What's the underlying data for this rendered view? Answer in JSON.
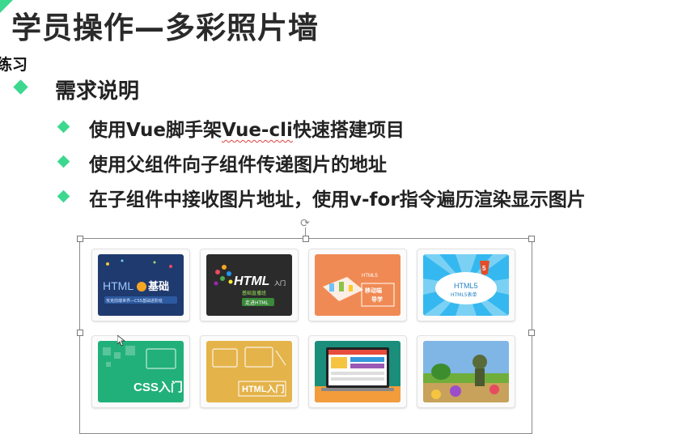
{
  "slide": {
    "title": "学员操作—多彩照片墙",
    "section_label": "练习",
    "heading": "需求说明",
    "bullets": [
      {
        "text_a": "使用Vue脚手架",
        "text_b": "Vue-cli",
        "text_c": "快速搭建项目"
      },
      {
        "text": "使用父组件向子组件传递图片的地址"
      },
      {
        "text": "在子组件中接收图片地址，使用v-for指令遍历渲染显示图片"
      }
    ]
  },
  "colors": {
    "accent": "#3dd88f",
    "spellcheck": "#e04040"
  },
  "gallery": {
    "rows": [
      [
        {
          "name": "html-basics",
          "label_a": "HTML",
          "label_b": "基础",
          "caption": "攻克前端世界—CSS基础进阶班",
          "bg": "#1f3a6e"
        },
        {
          "name": "html-intro",
          "label_a": "HTML",
          "label_b": "入门",
          "caption": "基础直播班",
          "badge": "走进HTML",
          "bg": "#2b2b2b"
        },
        {
          "name": "html5-mobile",
          "label_a": "HTML5",
          "label_b": "移动端",
          "caption": "导学",
          "bg": "#f08a54"
        },
        {
          "name": "html5-form",
          "label_a": "HTML5",
          "label_b": "HTML5表单",
          "bg": "#35b8ef"
        }
      ],
      [
        {
          "name": "css-intro",
          "label_a": "CSS入门",
          "bg": "#22b07a"
        },
        {
          "name": "html-intro-yellow",
          "label_a": "HTML入门",
          "bg": "#e4b34a"
        },
        {
          "name": "website-laptop",
          "bg": "#f2f2f2"
        },
        {
          "name": "plants-game",
          "bg": "#7fb6e6"
        }
      ]
    ]
  }
}
